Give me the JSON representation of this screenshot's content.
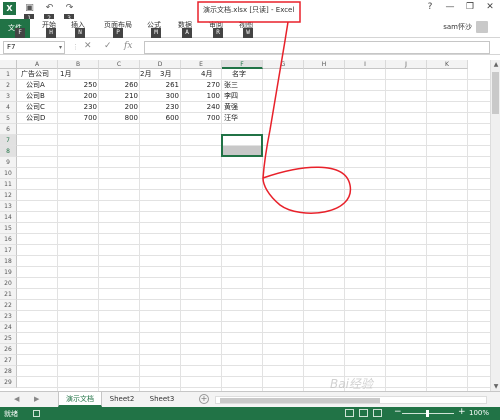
{
  "window": {
    "title": "演示文档.xlsx  [只读] - Excel",
    "user": "sam怀沙",
    "help": "?",
    "min": "—",
    "restore": "❐",
    "close": "✕"
  },
  "app_icon": "X",
  "quick_access": [
    {
      "icon": "save-icon",
      "glyph": "▣",
      "keytip": "1"
    },
    {
      "icon": "undo-icon",
      "glyph": "↶",
      "keytip": "2"
    },
    {
      "icon": "redo-icon",
      "glyph": "↷",
      "keytip": "3"
    }
  ],
  "ribbon": {
    "tabs": [
      {
        "label": "文件",
        "keytip": "F"
      },
      {
        "label": "开始",
        "keytip": "H"
      },
      {
        "label": "插入",
        "keytip": "N"
      },
      {
        "label": "页面布局",
        "keytip": "P"
      },
      {
        "label": "公式",
        "keytip": "M"
      },
      {
        "label": "数据",
        "keytip": "A"
      },
      {
        "label": "审阅",
        "keytip": "R"
      },
      {
        "label": "视图",
        "keytip": "W"
      }
    ]
  },
  "formula_bar": {
    "name_box": "F7",
    "cancel_glyph": "✕",
    "enter_glyph": "✓",
    "fx_glyph": "fx",
    "formula": ""
  },
  "sheet": {
    "columns": [
      "A",
      "B",
      "C",
      "D",
      "E",
      "F",
      "G",
      "H",
      "I",
      "J",
      "K"
    ],
    "active_column": "F",
    "rows": [
      "1",
      "2",
      "3",
      "4",
      "5",
      "6",
      "7",
      "8",
      "9",
      "10",
      "11",
      "12",
      "13",
      "14",
      "15",
      "16",
      "17",
      "18",
      "19",
      "20",
      "21",
      "22",
      "23",
      "24",
      "25",
      "26",
      "27",
      "28",
      "29"
    ],
    "active_rows": [
      "7",
      "8"
    ],
    "header_row": [
      "广告公司",
      "1月",
      "2月",
      "3月",
      "4月",
      "名字"
    ],
    "data_rows": [
      [
        "公司A",
        "250",
        "260",
        "261",
        "270",
        "张三"
      ],
      [
        "公司B",
        "200",
        "210",
        "300",
        "100",
        "李四"
      ],
      [
        "公司C",
        "230",
        "200",
        "230",
        "240",
        "黄强"
      ],
      [
        "公司D",
        "700",
        "800",
        "600",
        "700",
        "汪华"
      ]
    ]
  },
  "sheet_tabs": [
    "演示文档",
    "Sheet2",
    "Sheet3"
  ],
  "active_sheet": "演示文档",
  "sheet_nav": {
    "prev": "◀",
    "next": "▶",
    "add": "+",
    "more": "⋯"
  },
  "status": {
    "ready": "就绪",
    "zoom_minus": "−",
    "zoom_plus": "+",
    "zoom": "100%"
  },
  "colors": {
    "accent": "#217346",
    "annotation": "#e8212a"
  },
  "watermark": "Bai经验"
}
